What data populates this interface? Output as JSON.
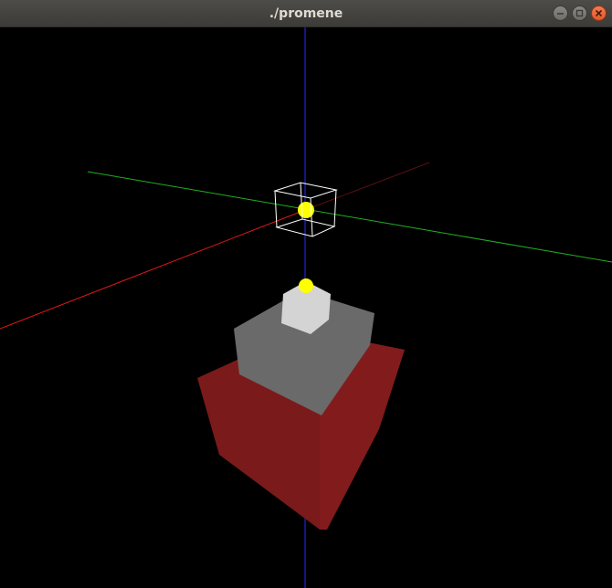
{
  "window": {
    "title": "./promene"
  },
  "controls": {
    "minimize_icon": "minimize-icon",
    "maximize_icon": "maximize-icon",
    "close_icon": "close-icon"
  },
  "scene": {
    "background": "#000000",
    "axis_colors": {
      "x": "#ff2020",
      "y": "#20c020",
      "z": "#2020ff"
    },
    "base_block_color": "#7d1a1a",
    "middle_block_color": "#6b6b6b",
    "top_block_color": "#d6d6d6",
    "light_color": "#ffff00",
    "wire_cube_color": "#ffffff"
  }
}
